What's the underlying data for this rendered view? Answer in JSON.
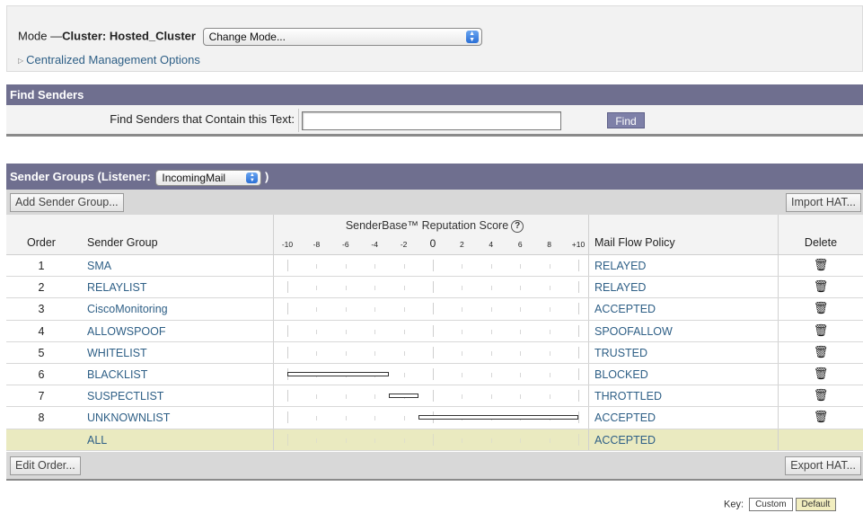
{
  "mode": {
    "prefix": "Mode —",
    "value": "Cluster: Hosted_Cluster",
    "select_value": "Change Mode...",
    "centralized_link": "Centralized Management Options"
  },
  "find_senders": {
    "title": "Find Senders",
    "label": "Find Senders that Contain this Text:",
    "input_value": "",
    "button": "Find"
  },
  "sender_groups": {
    "title_prefix": "Sender Groups (Listener:",
    "listener": "IncomingMail",
    "title_suffix": ")",
    "add_button": "Add Sender Group...",
    "import_button": "Import HAT...",
    "edit_order_button": "Edit Order...",
    "export_button": "Export HAT...",
    "columns": {
      "order": "Order",
      "group": "Sender Group",
      "score": "SenderBase™ Reputation Score",
      "policy": "Mail Flow Policy",
      "delete": "Delete"
    },
    "scale_labels": [
      "-10",
      "-8",
      "-6",
      "-4",
      "-2",
      "0",
      "2",
      "4",
      "6",
      "8",
      "+10"
    ],
    "rows": [
      {
        "order": "1",
        "group": "SMA",
        "policy": "RELAYED",
        "range": null
      },
      {
        "order": "2",
        "group": "RELAYLIST",
        "policy": "RELAYED",
        "range": null
      },
      {
        "order": "3",
        "group": "CiscoMonitoring",
        "policy": "ACCEPTED",
        "range": null
      },
      {
        "order": "4",
        "group": "ALLOWSPOOF",
        "policy": "SPOOFALLOW",
        "range": null
      },
      {
        "order": "5",
        "group": "WHITELIST",
        "policy": "TRUSTED",
        "range": null
      },
      {
        "order": "6",
        "group": "BLACKLIST",
        "policy": "BLOCKED",
        "range": [
          -10,
          -3
        ]
      },
      {
        "order": "7",
        "group": "SUSPECTLIST",
        "policy": "THROTTLED",
        "range": [
          -3,
          -1
        ]
      },
      {
        "order": "8",
        "group": "UNKNOWNLIST",
        "policy": "ACCEPTED",
        "range": [
          -1,
          10
        ]
      }
    ],
    "all_row": {
      "group": "ALL",
      "policy": "ACCEPTED"
    },
    "delete_icon": "trash-icon"
  },
  "key": {
    "label": "Key:",
    "custom": "Custom",
    "default": "Default"
  }
}
